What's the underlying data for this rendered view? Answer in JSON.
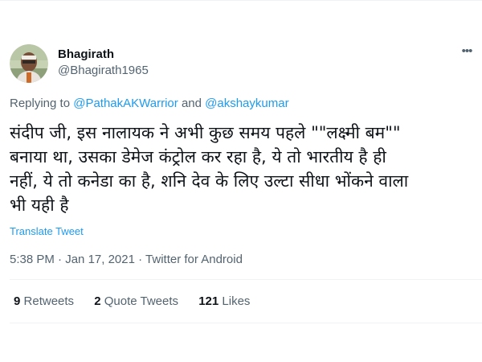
{
  "author": {
    "display_name": "Bhagirath",
    "handle": "@Bhagirath1965"
  },
  "reply_context": {
    "prefix": "Replying to",
    "mention_1": "@PathakAKWarrior",
    "joiner": "and",
    "mention_2": "@akshaykumar"
  },
  "tweet": {
    "text": "संदीप जी, इस नालायक ने अभी कुछ समय पहले \"\"लक्ष्मी बम\"\"\nबनाया था, उसका डेमेज कंट्रोल कर रहा है, ये तो भारतीय है ही\nनहीं, ये तो कनेडा का है, शनि देव के लिए उल्टा सीधा भोंकने वाला\nभी यही है",
    "translate_label": "Translate Tweet",
    "time": "5:38 PM",
    "date": "Jan 17, 2021",
    "separator": "·",
    "source": "Twitter for Android"
  },
  "stats": {
    "retweets_count": "9",
    "retweets_label": "Retweets",
    "quotes_count": "2",
    "quotes_label": "Quote Tweets",
    "likes_count": "121",
    "likes_label": "Likes"
  },
  "icons": {
    "more": "more-horizontal-icon",
    "avatar": "profile-photo"
  },
  "colors": {
    "link": "#1d9bf0",
    "secondary_text": "#536471",
    "primary_text": "#0f1419",
    "divider": "#eff3f4"
  }
}
